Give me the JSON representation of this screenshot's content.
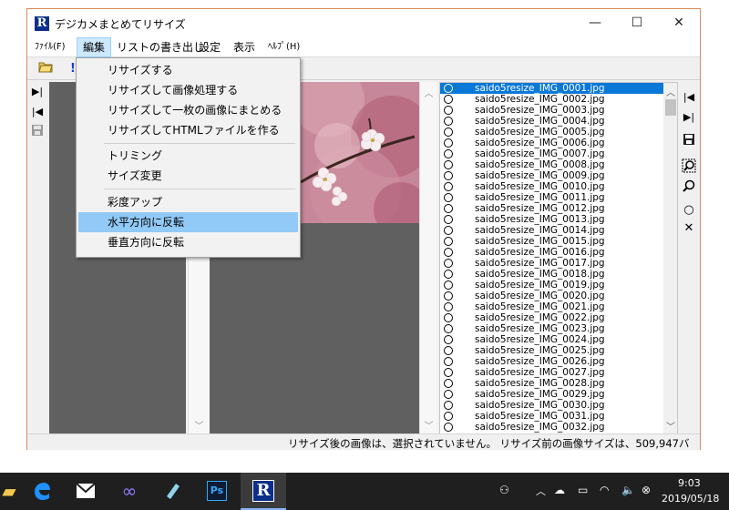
{
  "window": {
    "title": "デジカメまとめてリサイズ",
    "icon_letter": "R",
    "minimize": "—",
    "maximize": "☐",
    "close": "✕"
  },
  "menubar": {
    "items": [
      {
        "label": "ﾌｧｲﾙ(F)"
      },
      {
        "label": "編集"
      },
      {
        "label": "リストの書き出し"
      },
      {
        "label": "設定"
      },
      {
        "label": "表示"
      },
      {
        "label": "ﾍﾙﾌﾟ(H)"
      }
    ]
  },
  "edit_menu": {
    "items": [
      {
        "label": "リサイズする"
      },
      {
        "label": "リサイズして画像処理する"
      },
      {
        "label": "リサイズして一枚の画像にまとめる"
      },
      {
        "label": "リサイズしてHTMLファイルを作る"
      },
      {
        "label": "トリミング"
      },
      {
        "label": "サイズ変更"
      },
      {
        "label": "彩度アップ"
      },
      {
        "label": "水平方向に反転"
      },
      {
        "label": "垂直方向に反転"
      }
    ],
    "highlighted_index": 7
  },
  "file_list": {
    "selected_index": 0,
    "files": [
      "saido5resize_IMG_0001.jpg",
      "saido5resize_IMG_0002.jpg",
      "saido5resize_IMG_0003.jpg",
      "saido5resize_IMG_0004.jpg",
      "saido5resize_IMG_0005.jpg",
      "saido5resize_IMG_0006.jpg",
      "saido5resize_IMG_0007.jpg",
      "saido5resize_IMG_0008.jpg",
      "saido5resize_IMG_0009.jpg",
      "saido5resize_IMG_0010.jpg",
      "saido5resize_IMG_0011.jpg",
      "saido5resize_IMG_0012.jpg",
      "saido5resize_IMG_0013.jpg",
      "saido5resize_IMG_0014.jpg",
      "saido5resize_IMG_0015.jpg",
      "saido5resize_IMG_0016.jpg",
      "saido5resize_IMG_0017.jpg",
      "saido5resize_IMG_0018.jpg",
      "saido5resize_IMG_0019.jpg",
      "saido5resize_IMG_0020.jpg",
      "saido5resize_IMG_0021.jpg",
      "saido5resize_IMG_0022.jpg",
      "saido5resize_IMG_0023.jpg",
      "saido5resize_IMG_0024.jpg",
      "saido5resize_IMG_0025.jpg",
      "saido5resize_IMG_0026.jpg",
      "saido5resize_IMG_0027.jpg",
      "saido5resize_IMG_0028.jpg",
      "saido5resize_IMG_0029.jpg",
      "saido5resize_IMG_0030.jpg",
      "saido5resize_IMG_0031.jpg",
      "saido5resize_IMG_0032.jpg"
    ]
  },
  "statusbar": {
    "text": "リサイズ後の画像は、選択されていません。 リサイズ前の画像サイズは、509,947バ"
  },
  "taskbar": {
    "active_app_letter": "R",
    "photoshop_label": "Ps",
    "clock_time": "9:03",
    "clock_date": "2019/05/18"
  },
  "colors": {
    "window_border": "#e08a5a",
    "selection_blue": "#0a78d7",
    "menu_highlight": "#91c9f7",
    "taskbar": "#1f1f1f"
  }
}
